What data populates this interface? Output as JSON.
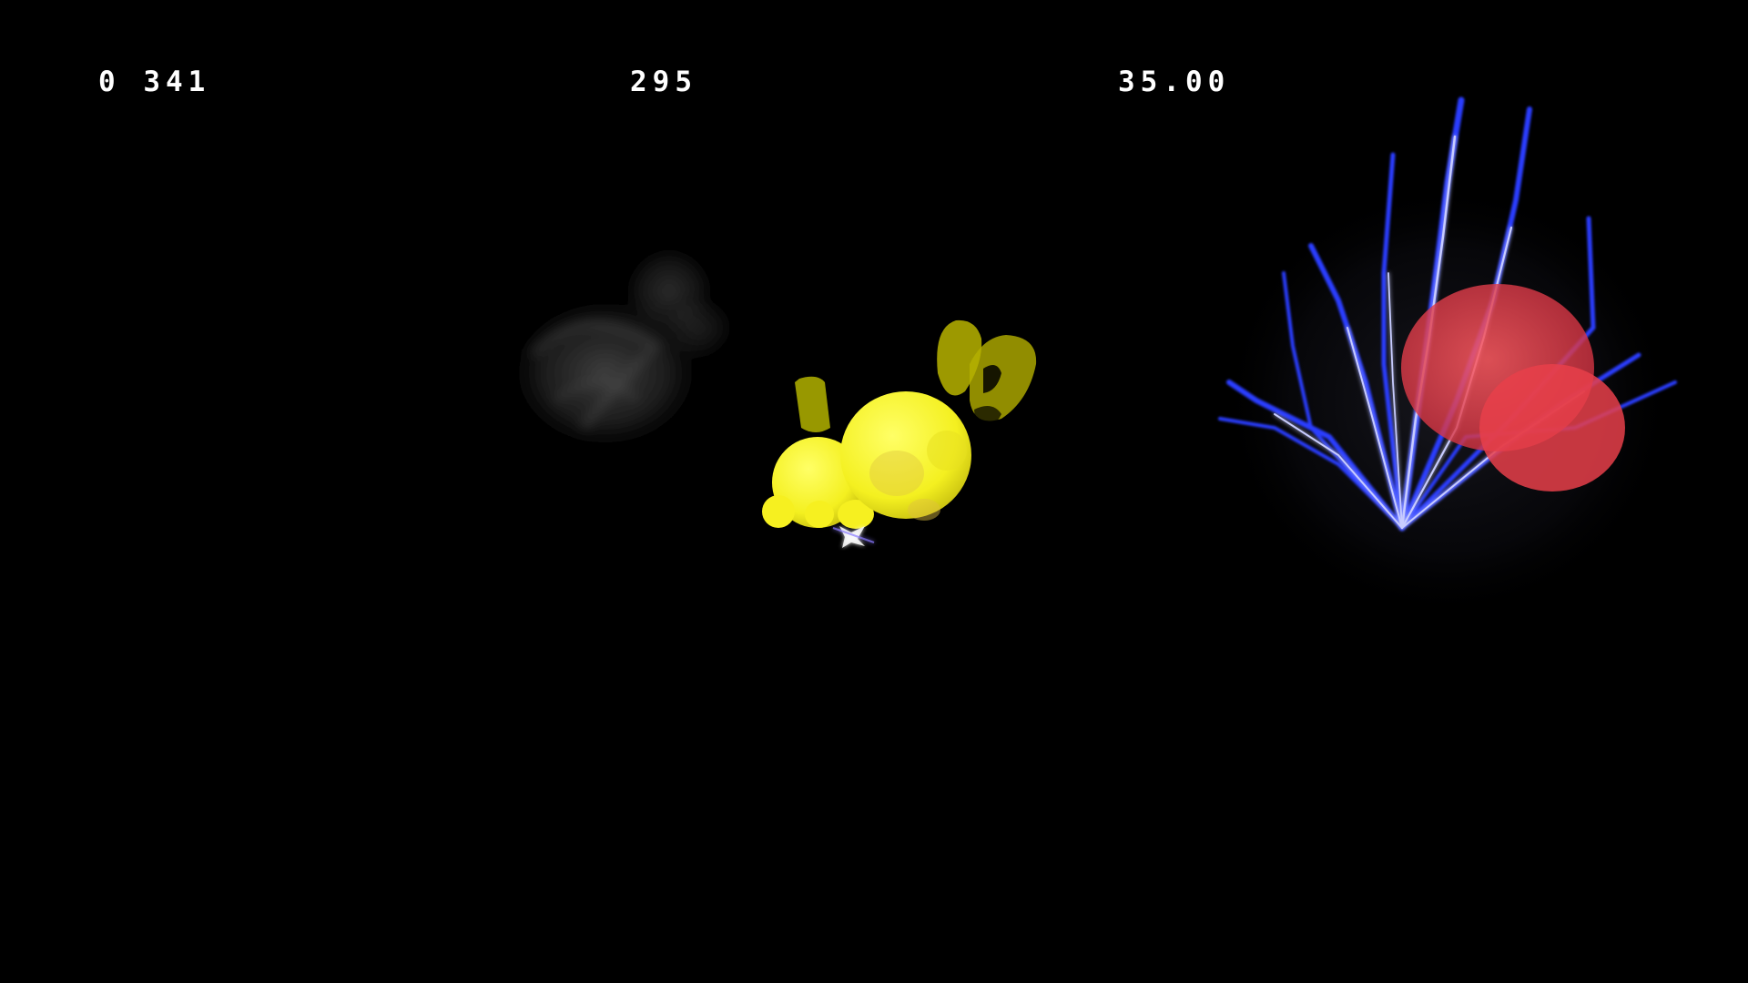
{
  "hud": {
    "left_readout": "0 341",
    "center_readout": "295",
    "right_readout": "35.00"
  },
  "scene": {
    "background_color": "#000000",
    "player_color": "#ffff33",
    "smoke_color": "#3a3a3a",
    "lightning_color": "#2a3cff",
    "orb_color": "#e0404a",
    "sparkle_color": "#e8e8ff"
  }
}
